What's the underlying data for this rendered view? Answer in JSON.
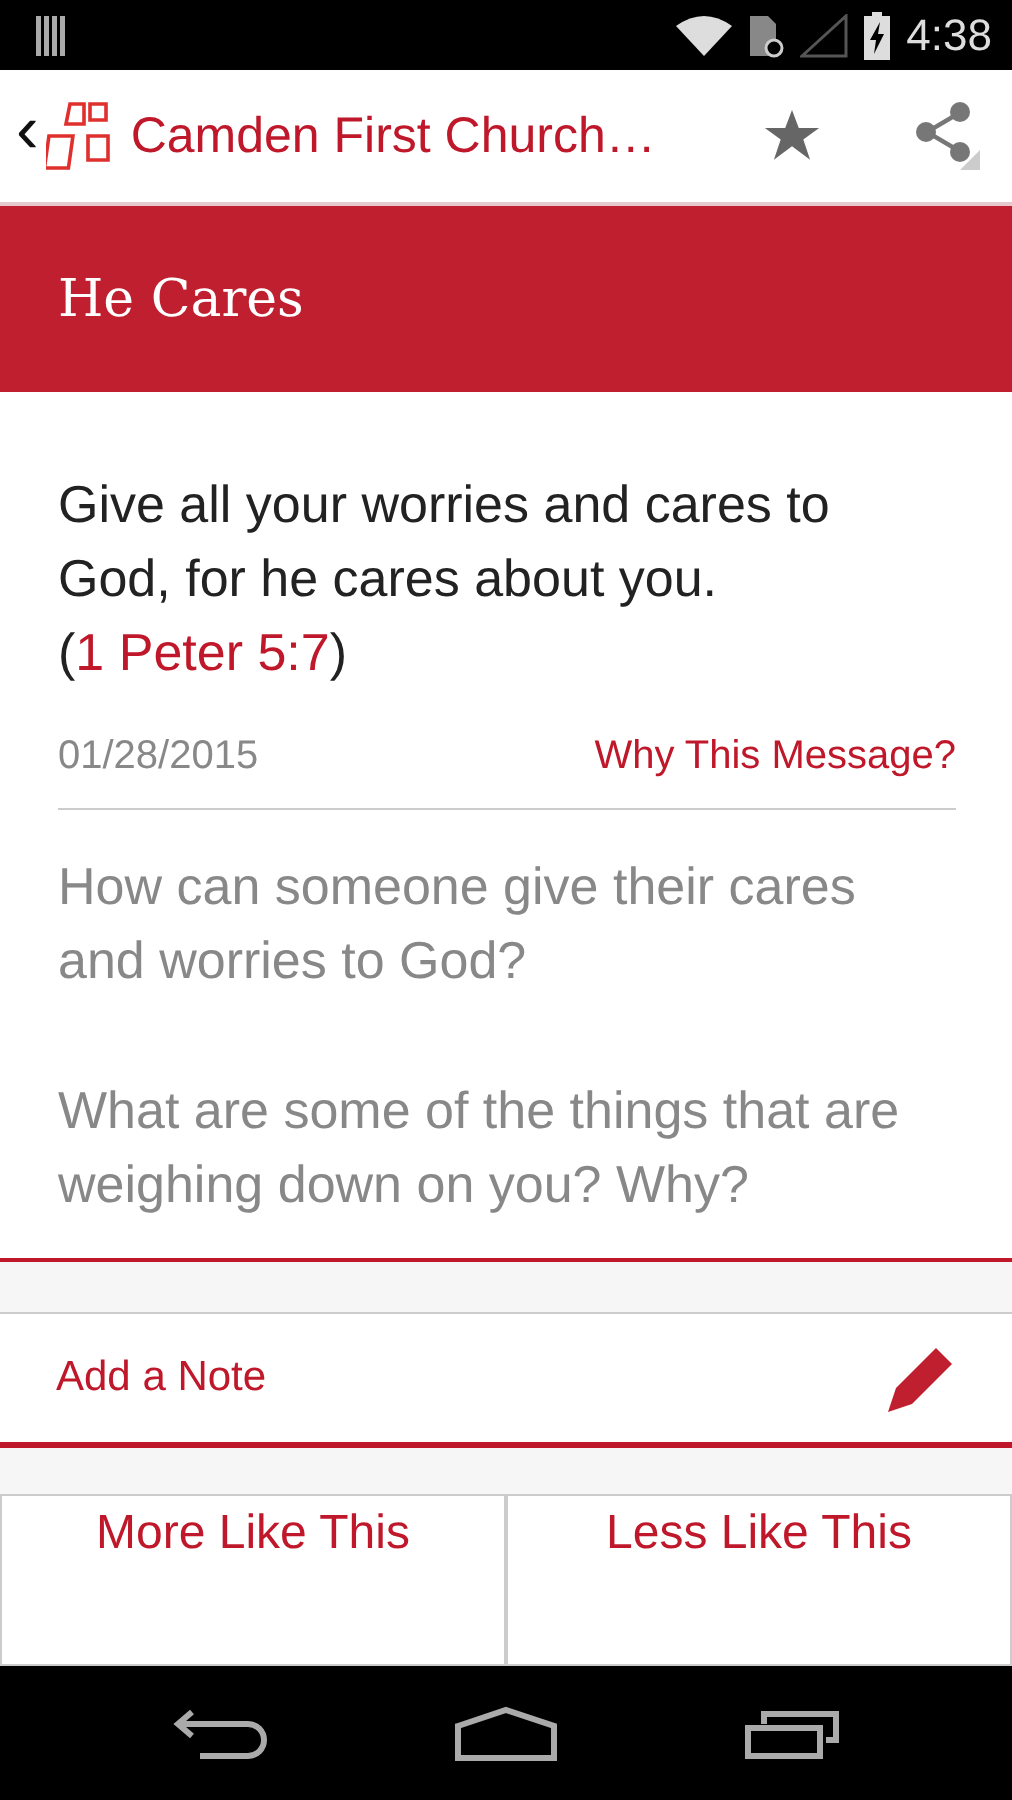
{
  "status_bar": {
    "time": "4:38"
  },
  "app_bar": {
    "back": "‹",
    "title": "Camden First Church…"
  },
  "header": {
    "title": "He Cares"
  },
  "message": {
    "verse": "Give all your worries and cares to God, for he cares about you. (",
    "reference": "1 Peter 5:7",
    "verse_end": ")",
    "date": "01/28/2015",
    "why_link": "Why This Message?"
  },
  "questions": [
    "How can someone give their cares and worries to God?",
    "What are some of the things that are weighing down on you? Why?"
  ],
  "note": {
    "label": "Add a Note"
  },
  "buttons": [
    {
      "label": "More Like This"
    },
    {
      "label": "Less Like This"
    }
  ]
}
